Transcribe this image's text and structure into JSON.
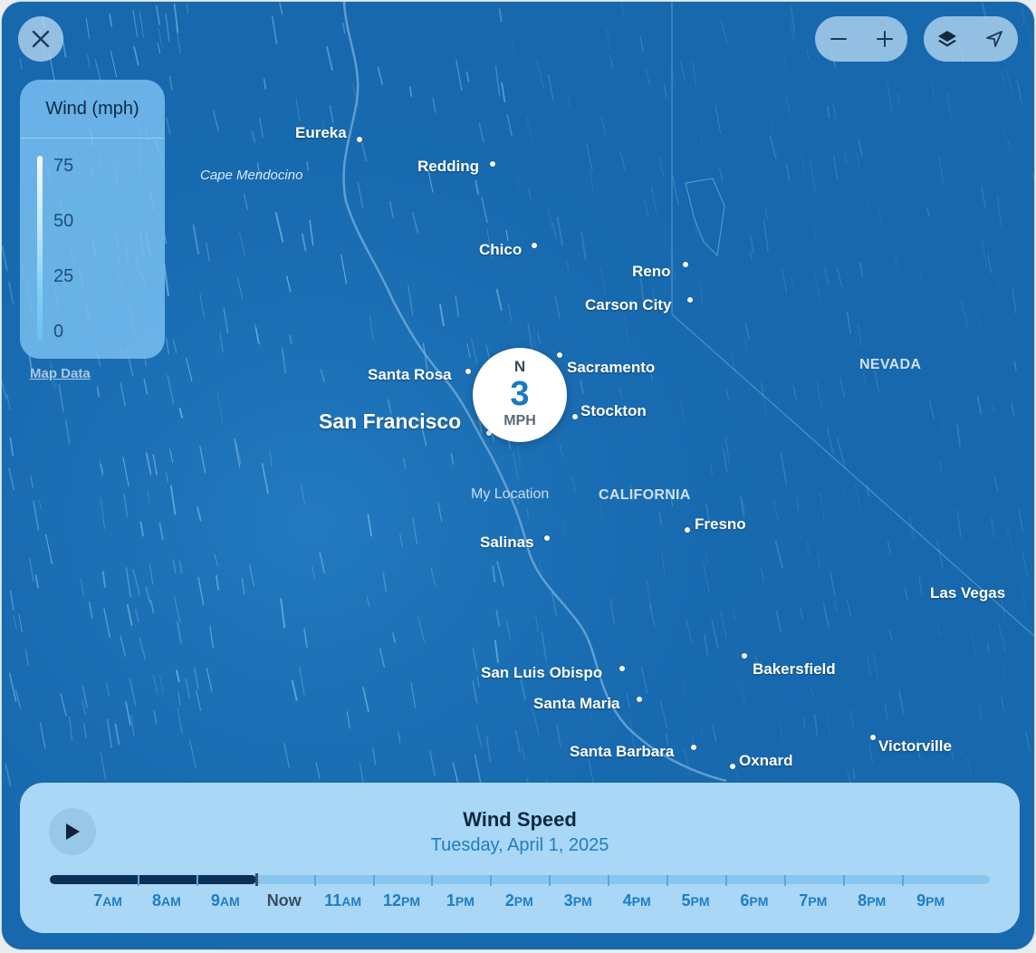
{
  "legend": {
    "title": "Wind (mph)",
    "ticks": [
      "75",
      "50",
      "25",
      "0"
    ],
    "map_data_link": "Map Data"
  },
  "map": {
    "cities": [
      {
        "name": "Eureka"
      },
      {
        "name": "Redding"
      },
      {
        "name": "Chico"
      },
      {
        "name": "Reno"
      },
      {
        "name": "Carson City"
      },
      {
        "name": "Santa Rosa"
      },
      {
        "name": "Sacramento"
      },
      {
        "name": "San Francisco"
      },
      {
        "name": "Stockton"
      },
      {
        "name": "Fresno"
      },
      {
        "name": "Salinas"
      },
      {
        "name": "Las Vegas"
      },
      {
        "name": "Bakersfield"
      },
      {
        "name": "San Luis Obispo"
      },
      {
        "name": "Santa Maria"
      },
      {
        "name": "Santa Barbara"
      },
      {
        "name": "Oxnard"
      },
      {
        "name": "Victorville"
      }
    ],
    "regions": [
      "NEVADA",
      "CALIFORNIA"
    ],
    "feature_label": "Cape Mendocino",
    "my_location_label": "My Location"
  },
  "wind_marker": {
    "direction": "N",
    "speed": "3",
    "unit": "MPH"
  },
  "controls": {
    "zoom_out_icon": "minus-icon",
    "zoom_in_icon": "plus-icon",
    "layers_icon": "layers-icon",
    "location_icon": "location-arrow-icon",
    "close_icon": "close-icon"
  },
  "timeline": {
    "title": "Wind Speed",
    "date": "Tuesday, April 1, 2025",
    "progress_fraction": 0.22,
    "hours": [
      {
        "num": "7",
        "sfx": "AM"
      },
      {
        "num": "8",
        "sfx": "AM"
      },
      {
        "num": "9",
        "sfx": "AM"
      },
      {
        "num": "Now",
        "sfx": ""
      },
      {
        "num": "11",
        "sfx": "AM"
      },
      {
        "num": "12",
        "sfx": "PM"
      },
      {
        "num": "1",
        "sfx": "PM"
      },
      {
        "num": "2",
        "sfx": "PM"
      },
      {
        "num": "3",
        "sfx": "PM"
      },
      {
        "num": "4",
        "sfx": "PM"
      },
      {
        "num": "5",
        "sfx": "PM"
      },
      {
        "num": "6",
        "sfx": "PM"
      },
      {
        "num": "7",
        "sfx": "PM"
      },
      {
        "num": "8",
        "sfx": "PM"
      },
      {
        "num": "9",
        "sfx": "PM"
      }
    ]
  },
  "colors": {
    "map_water": "#1568ad",
    "accent": "#1f7dc4",
    "track_fill": "#0b2f57"
  }
}
